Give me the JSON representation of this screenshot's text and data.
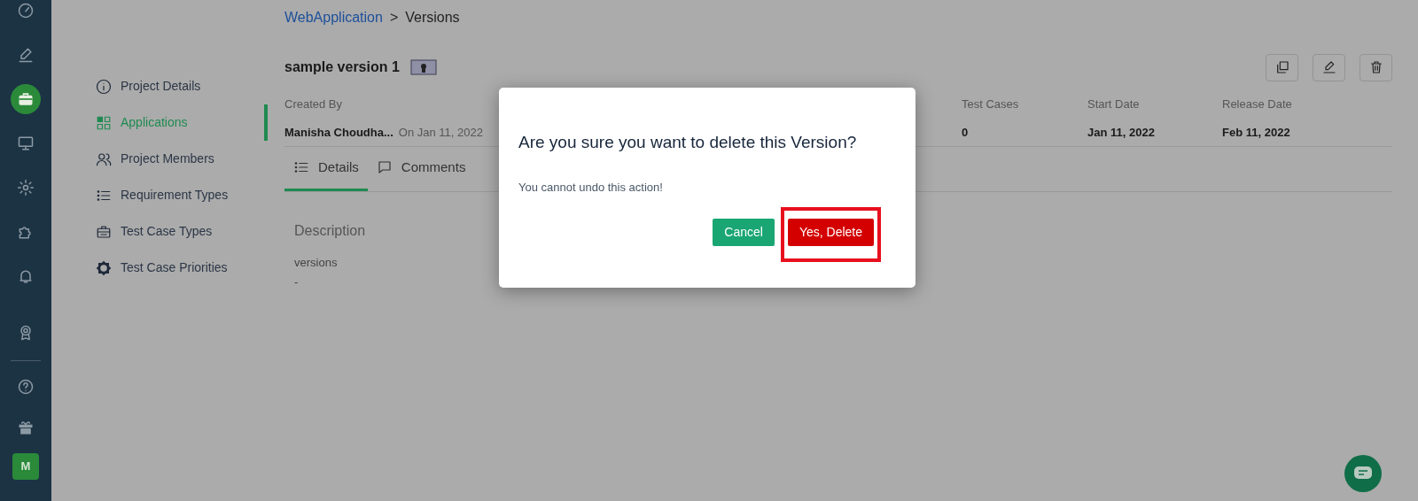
{
  "rail": {
    "items": [
      {
        "selected": false
      },
      {
        "selected": false
      },
      {
        "selected": true
      },
      {
        "selected": false
      },
      {
        "selected": false
      },
      {
        "selected": false
      },
      {
        "selected": false
      },
      {
        "selected": false
      },
      {
        "selected": false
      },
      {
        "selected": false
      }
    ],
    "avatar": "M"
  },
  "settings_nav": [
    {
      "label": "Project Details",
      "selected": false
    },
    {
      "label": "Applications",
      "selected": true
    },
    {
      "label": "Project Members",
      "selected": false
    },
    {
      "label": "Requirement Types",
      "selected": false
    },
    {
      "label": "Test Case Types",
      "selected": false
    },
    {
      "label": "Test Case Priorities",
      "selected": false
    }
  ],
  "breadcrumb": {
    "link": "WebApplication",
    "separator": ">",
    "current": "Versions"
  },
  "version": {
    "title": "sample version 1"
  },
  "meta": [
    {
      "label": "Created By",
      "value": "Manisha Choudha...",
      "note": "On Jan 11, 2022"
    },
    {
      "label": "Test Cases",
      "value": "0"
    },
    {
      "label": "Start Date",
      "value": "Jan 11, 2022"
    },
    {
      "label": "Release Date",
      "value": "Feb 11, 2022"
    }
  ],
  "tabs": [
    {
      "label": "Details",
      "selected": true
    },
    {
      "label": "Comments",
      "selected": false
    }
  ],
  "description": {
    "heading": "Description",
    "lines": [
      "versions",
      "-"
    ]
  },
  "dialog": {
    "title": "Are you sure you want to delete this Version?",
    "message": "You cannot undo this action!",
    "buttons": [
      {
        "kind": "cancel",
        "label": "Cancel",
        "highlighted": false
      },
      {
        "kind": "danger",
        "label": "Yes, Delete",
        "highlighted": true
      }
    ]
  }
}
